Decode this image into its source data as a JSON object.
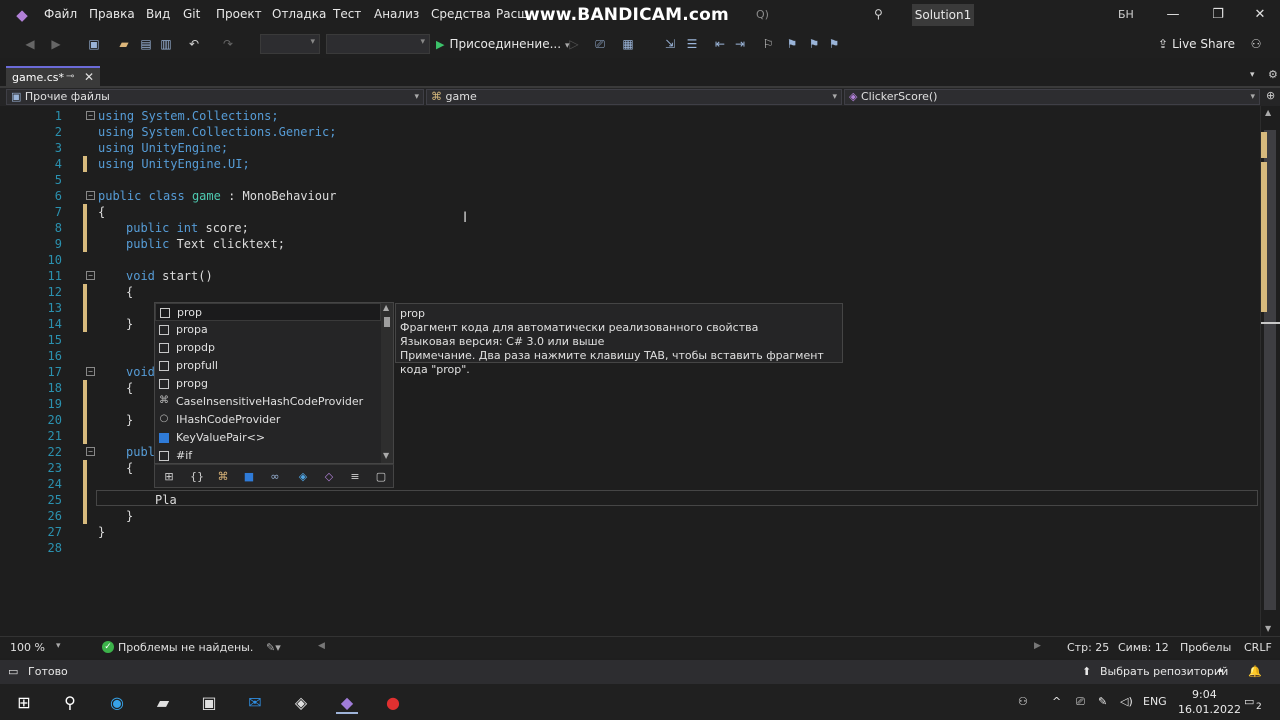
{
  "menu": [
    "Файл",
    "Правка",
    "Вид",
    "Git",
    "Проект",
    "Отладка",
    "Тест",
    "Анализ",
    "Средства",
    "Расш"
  ],
  "watermark": "www.BANDICAM.com",
  "search_suffix": "Q)",
  "solution": "Solution1",
  "user_initials": "БН",
  "toolbar": {
    "run_label": "Присоединение...",
    "live_share": "Live Share"
  },
  "tab": {
    "label": "game.cs*",
    "pin": "⊸",
    "close": "✕"
  },
  "nav": {
    "project": "Прочие файлы",
    "class": "game",
    "member": "ClickerScore()"
  },
  "code": {
    "l1": "using System.Collections;",
    "l2": "using System.Collections.Generic;",
    "l3": "using UnityEngine;",
    "l4": "using UnityEngine.UI;",
    "l6_kw": "public class",
    "l6_ty": "game",
    "l6_rest": " : MonoBehaviour",
    "l7": "{",
    "l8_kw": "public int",
    "l8_rest": " score;",
    "l9_kw": "public",
    "l9_rest": " Text clicktext;",
    "l11_kw": "void",
    "l11_rest": " start()",
    "l12": "{",
    "l14": "}",
    "l17": "void",
    "l18": "{",
    "l20": "}",
    "l22": "publ",
    "l23": "{",
    "l25": "Pla",
    "l26": "}",
    "l27": "}"
  },
  "line_numbers": [
    "1",
    "2",
    "3",
    "4",
    "5",
    "6",
    "7",
    "8",
    "9",
    "10",
    "11",
    "12",
    "13",
    "14",
    "15",
    "16",
    "17",
    "18",
    "19",
    "20",
    "21",
    "22",
    "23",
    "24",
    "25",
    "26",
    "27",
    "28"
  ],
  "completion": {
    "items": [
      "prop",
      "propa",
      "propdp",
      "propfull",
      "propg",
      "CaseInsensitiveHashCodeProvider",
      "IHashCodeProvider",
      "KeyValuePair<>",
      "#if"
    ]
  },
  "tooltip": {
    "title": "prop",
    "line1": "Фрагмент кода для автоматически реализованного свойства",
    "line2": "Языковая версия: C# 3.0 или выше",
    "line3": "Примечание. Два раза нажмите клавишу TAB, чтобы вставить фрагмент кода \"prop\"."
  },
  "editor_status": {
    "zoom": "100 %",
    "problems": "Проблемы не найдены.",
    "line": "Стр: 25",
    "col": "Симв: 12",
    "ws": "Пробелы",
    "eol": "CRLF"
  },
  "statusbar": {
    "ready": "Готово",
    "repo": "Выбрать репозиторий"
  },
  "taskbar": {
    "lang": "ENG",
    "time": "9:04",
    "date": "16.01.2022",
    "notifications": "2"
  },
  "colors": {
    "keyword": "#569cd6",
    "type": "#4ec9b0",
    "line_number": "#2b91af",
    "change_marker": "#d7ba7d"
  }
}
